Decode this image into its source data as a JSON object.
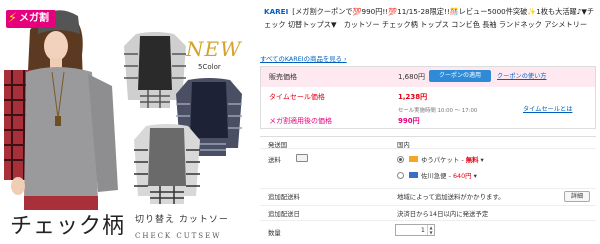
{
  "product_image": {
    "badge": "メガ割",
    "new_label": "NEW",
    "color_label": "5Color",
    "title": "チェック柄",
    "subtitle": "切り替え カットソー",
    "subtitle_en": "CHECK CUTSEW"
  },
  "listing": {
    "brand": "KAREI",
    "title": "[メガ割クーポンで💯990円!!💯11/15-28限定!!🎊レビュー5000件突破✨1枚も大活躍♪▼チェック 切替トップス▼　カットソー チェック柄 トップス コンビ色 長袖 ランドネック アシメトリー",
    "all_link": "すべてのKAREIの商品を見る ›"
  },
  "price": {
    "sale_label": "販売価格",
    "sale_value": "1,680円",
    "coupon_button": "クーポンの適用",
    "coupon_link": "クーポンの使い方",
    "timesale_label": "タイムセール価格",
    "timesale_value": "1,238円",
    "timesale_note": "セール実施時間 10:00 ～ 17:00",
    "timesale_link": "タイムセールとは",
    "mega_label": "メガ割適用後の価格",
    "mega_value": "990円"
  },
  "shipping": {
    "origin_label": "発送国",
    "origin_value": "国内",
    "fee_label": "送料",
    "option1_name": "ゆうパケット",
    "option1_price": "無料",
    "option2_name": "佐川急便",
    "option2_price": "640円",
    "extra_label": "追加配送料",
    "extra_value": "地域によって追加送料がかかります。",
    "detail_button": "詳細",
    "date_label": "追加配送日",
    "date_value": "決済日から14日以内に発送予定",
    "qty_label": "数量",
    "qty_value": "1"
  },
  "colors": {
    "accent": "#e60012",
    "link": "#0060c0",
    "coupon": "#2f8bd8",
    "badge": "#e6007e"
  }
}
